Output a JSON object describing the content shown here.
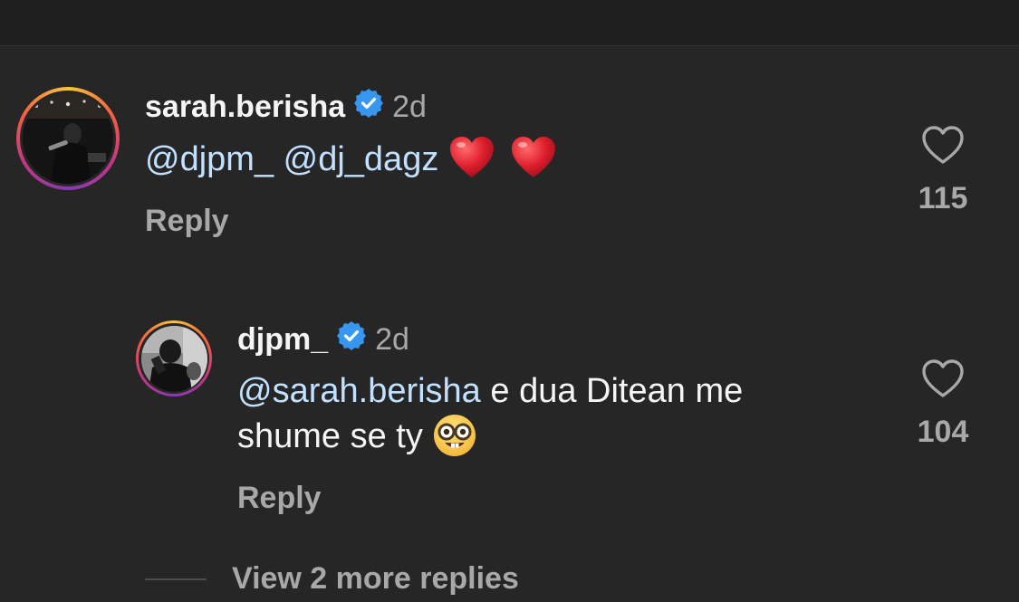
{
  "colors": {
    "background": "#262626",
    "text_primary": "#f5f5f5",
    "text_secondary": "#a8a8a8",
    "mention": "#c2e0ff",
    "verified_badge": "#3797f0",
    "heart_emoji": "#e0202e"
  },
  "comments": [
    {
      "username": "sarah.berisha",
      "verified": true,
      "time": "2d",
      "mention_1": "@djpm_",
      "mention_2": "@dj_dagz",
      "emoji": [
        "red-heart",
        "red-heart"
      ],
      "reply_label": "Reply",
      "likes": "115",
      "icons": {
        "avatar": "avatar-photo",
        "like": "heart-outline-icon",
        "badge": "verified-badge-icon"
      }
    },
    {
      "username": "djpm_",
      "verified": true,
      "time": "2d",
      "mention": "@sarah.berisha",
      "text_line1_rest": " e dua Ditean me",
      "text_line2": "shume se ty ",
      "emoji": [
        "nerd-face"
      ],
      "reply_label": "Reply",
      "likes": "104",
      "icons": {
        "avatar": "avatar-photo",
        "like": "heart-outline-icon",
        "badge": "verified-badge-icon"
      }
    }
  ],
  "view_more_replies": "View 2 more replies"
}
